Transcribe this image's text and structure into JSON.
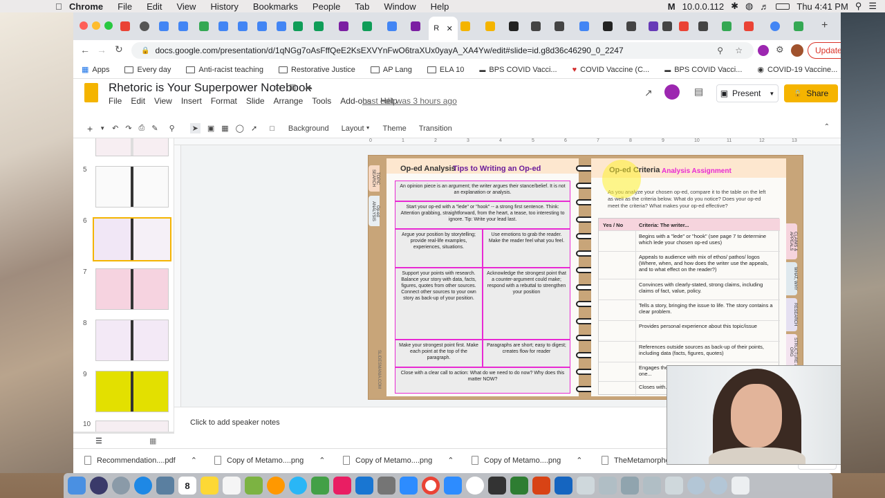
{
  "menubar": {
    "app": "Chrome",
    "items": [
      "File",
      "Edit",
      "View",
      "History",
      "Bookmarks",
      "People",
      "Tab",
      "Window",
      "Help"
    ],
    "ip": "10.0.0.112",
    "clock": "Thu 4:41 PM"
  },
  "tabs": {
    "active_label": "R",
    "new_tab": "+"
  },
  "omnibox": {
    "url": "docs.google.com/presentation/d/1qNGg7oAsFffQeE2KsEXVYnFwO6traXUx0yayA_XA4Yw/edit#slide=id.g8d36c46290_0_2247",
    "update_label": "Update"
  },
  "bookmarks": [
    "Apps",
    "Every day",
    "Anti-racist teaching",
    "Restorative Justice",
    "AP Lang",
    "ELA 10",
    "BPS COVID Vacci...",
    "COVID Vaccine (C...",
    "BPS COVID Vacci...",
    "COVID-19 Vaccine..."
  ],
  "docs": {
    "title": "Rhetoric is Your Superpower Notebook",
    "menus": [
      "File",
      "Edit",
      "View",
      "Insert",
      "Format",
      "Slide",
      "Arrange",
      "Tools",
      "Add-ons",
      "Help"
    ],
    "last_edit": "Last edit was 3 hours ago",
    "present": "Present",
    "share": "Share"
  },
  "toolbar": {
    "background": "Background",
    "layout": "Layout",
    "theme": "Theme",
    "transition": "Transition"
  },
  "filmstrip": {
    "numbers": [
      "5",
      "6",
      "7",
      "8",
      "9",
      "10"
    ]
  },
  "slide": {
    "left_title_a": "Op-ed Analysis",
    "left_title_b": "Tips to Writing an Op-ed",
    "tab_topic": "TOPIC SEARCH",
    "tab_oped": "Op-ed ANALYSIS",
    "watermark": "SLIDESMANIA.COM",
    "cells": [
      "An opinion piece is an argument; the writer argues their stance/belief. It is not an explanation or analysis.",
      "Start your op-ed with a \"lede\" or \"hook\" -- a strong first sentence. Think: Attention grabbing, straightforward, from the heart, a tease, too interesting to ignore. Tip: Write your lead last.",
      "Argue your position by storytelling; provide real-life examples, experiences, situations.",
      "Use emotions to grab the reader. Make the reader feel what you feel.",
      "Support your points with research. Balance your story with data, facts, figures, quotes from other sources. Connect other sources to your own story as back-up of your position.",
      "Acknowledge the strongest point that a counter-argument could make; respond with a rebuttal to strengthen your position",
      "Make your strongest point first. Make each point at the top of the paragraph.",
      "Paragraphs are short; easy to digest; creates flow for reader",
      "Close with a clear call to action: What do we need to do now? Why does this matter NOW?"
    ],
    "right_title_a": "Op-ed Criteria",
    "right_title_b": "Analysis Assignment",
    "right_intro": "As you analyze your chosen op-ed, compare it to the table on the left as well as the criteria below. What do you notice? Does your op-ed meet the criteria? What makes your op-ed effective?",
    "col_yes": "Yes / No",
    "col_criteria": "Criteria: The writer...",
    "criteria": [
      "Begins with a \"lede\" or \"hook\" (see page 7 to determine which lede your chosen op-ed uses)",
      "Appeals to audience with mix of ethos/ pathos/ logos (Where, when, and how does the writer use the appeals, and to what effect on the reader?)",
      "Convinces with clearly-stated, strong claims, including claims of fact, value, policy.",
      "Tells a story, bringing the issue to life. The story contains a clear problem.",
      "Provides personal experience about this topic/issue",
      "References outside sources as back-up of their points, including data (facts, figures, quotes)",
      "Engages the reader through rhetorical devices (Which one...",
      "Closes with..."
    ],
    "side_tabs": [
      "CLAIMS & APPEALS",
      "WHAT, WHY",
      "RESEARCH",
      "STRUCTURE & ORG"
    ]
  },
  "notes": {
    "placeholder": "Click to add speaker notes"
  },
  "downloads": {
    "items": [
      "Recommendation....pdf",
      "Copy of Metamo....png",
      "Copy of Metamo....png",
      "Copy of Metamo....png",
      "TheMetamorphos....zip"
    ],
    "show_all": "Show All"
  },
  "dock": {
    "calendar_day": "8"
  },
  "colors": {
    "slides_yellow": "#f4b400",
    "magenta": "#e829d3",
    "link": "#1a0dab",
    "share": "#f5b400"
  }
}
